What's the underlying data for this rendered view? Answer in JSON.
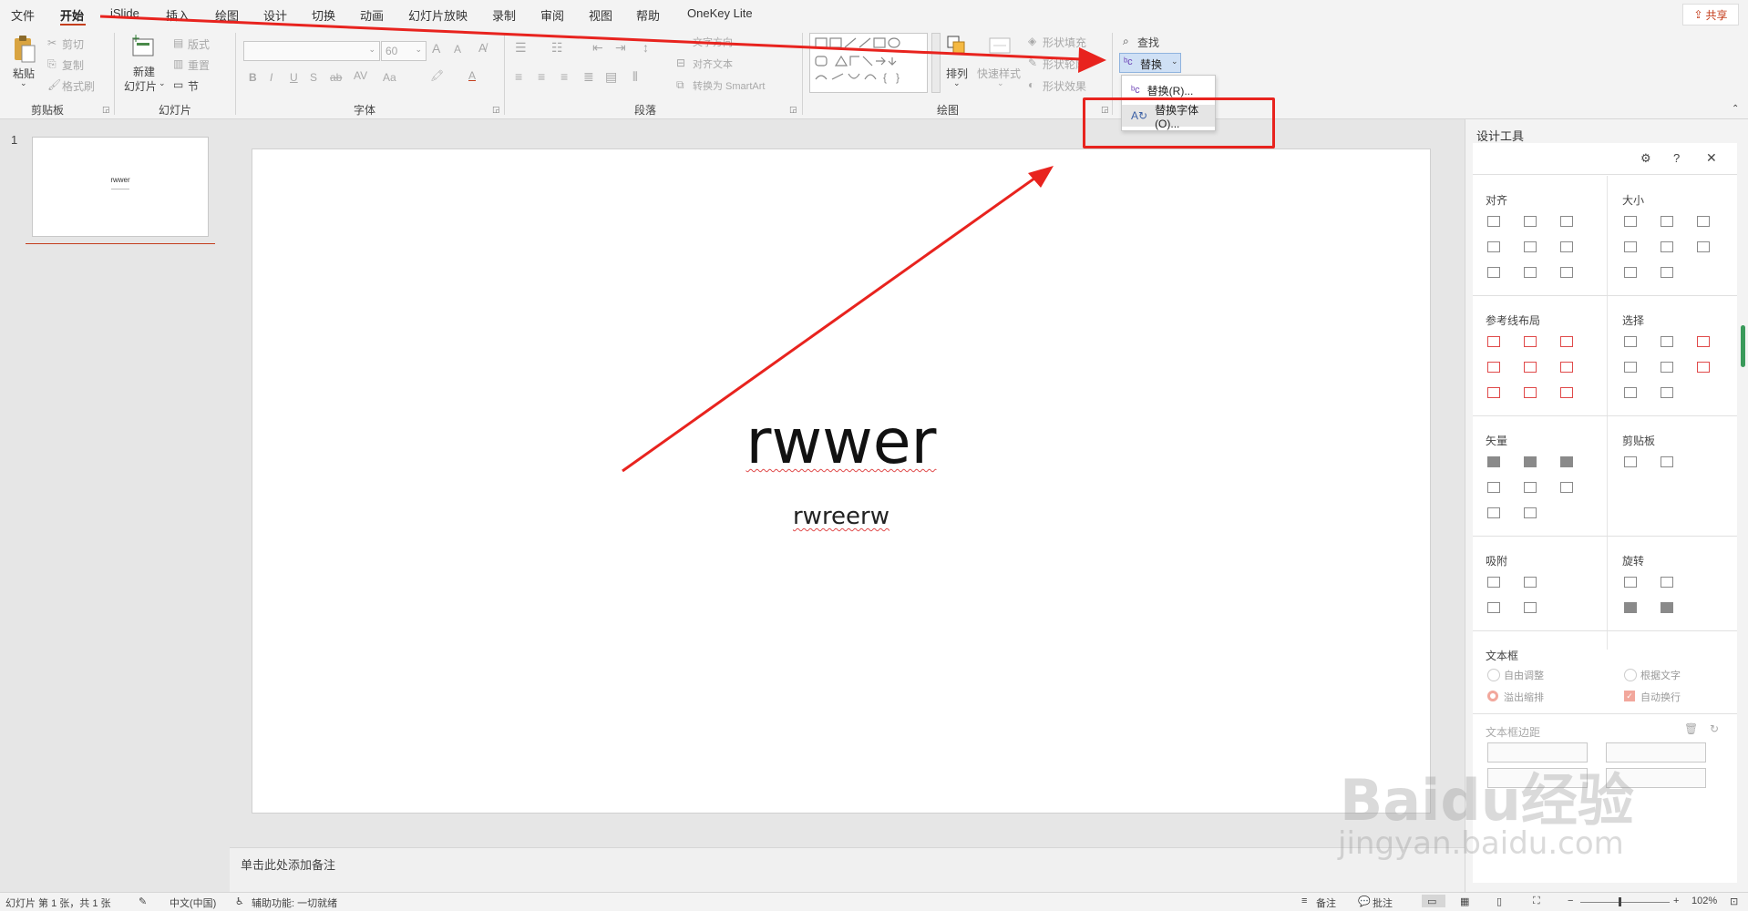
{
  "menubar": {
    "tabs": [
      "文件",
      "开始",
      "iSlide",
      "插入",
      "绘图",
      "设计",
      "切换",
      "动画",
      "幻灯片放映",
      "录制",
      "审阅",
      "视图",
      "帮助",
      "OneKey Lite"
    ],
    "active_tab": "开始",
    "share_label": "共享"
  },
  "ribbon": {
    "clipboard": {
      "paste": "粘贴",
      "cut": "剪切",
      "copy": "复制",
      "format_painter": "格式刷",
      "label": "剪贴板"
    },
    "slides": {
      "new_slide_line1": "新建",
      "new_slide_line2": "幻灯片",
      "layout": "版式",
      "reset": "重置",
      "section": "节",
      "label": "幻灯片"
    },
    "font": {
      "font_size": "60",
      "bold": "B",
      "italic": "I",
      "underline": "U",
      "shadow": "S",
      "strike": "ab",
      "spacing": "AV",
      "case": "Aa",
      "grow": "A",
      "shrink": "A",
      "label": "字体"
    },
    "paragraph": {
      "text_direction": "文字方向",
      "align_text": "对齐文本",
      "convert_smartart": "转换为 SmartArt",
      "label": "段落"
    },
    "drawing": {
      "arrange": "排列",
      "quick_styles": "快速样式",
      "shape_fill": "形状填充",
      "shape_outline": "形状轮廓",
      "shape_effects": "形状效果",
      "label": "绘图"
    },
    "editing": {
      "find": "查找",
      "replace": "替换"
    }
  },
  "dropdown": {
    "items": [
      {
        "label": "替换(R)..."
      },
      {
        "label": "替换字体(O)..."
      }
    ]
  },
  "thumbnails": [
    {
      "number": "1",
      "title": "rwwer"
    }
  ],
  "slide": {
    "title": "rwwer",
    "subtitle": "rwreerw"
  },
  "notes": {
    "placeholder": "单击此处添加备注"
  },
  "design_pane": {
    "title": "设计工具",
    "sections": {
      "align": "对齐",
      "size": "大小",
      "guides": "参考线布局",
      "select": "选择",
      "vector": "矢量",
      "clipboard": "剪贴板",
      "snap": "吸附",
      "rotate": "旋转",
      "textbox": "文本框",
      "margin": "文本框边距"
    },
    "textbox_options": {
      "auto_adjust": "自由调整",
      "fit_text": "根据文字",
      "overflow": "溢出缩排",
      "auto_wrap": "自动换行"
    }
  },
  "statusbar": {
    "slide_info": "幻灯片 第 1 张，共 1 张",
    "language": "中文(中国)",
    "accessibility": "辅助功能: 一切就绪",
    "notes_button": "备注",
    "comments_button": "批注",
    "zoom": "102%"
  },
  "watermark": {
    "text": "Baidu经验",
    "url": "jingyan.baidu.com"
  },
  "colors": {
    "accent": "#c43e1c",
    "annotation_red": "#e8231e"
  }
}
